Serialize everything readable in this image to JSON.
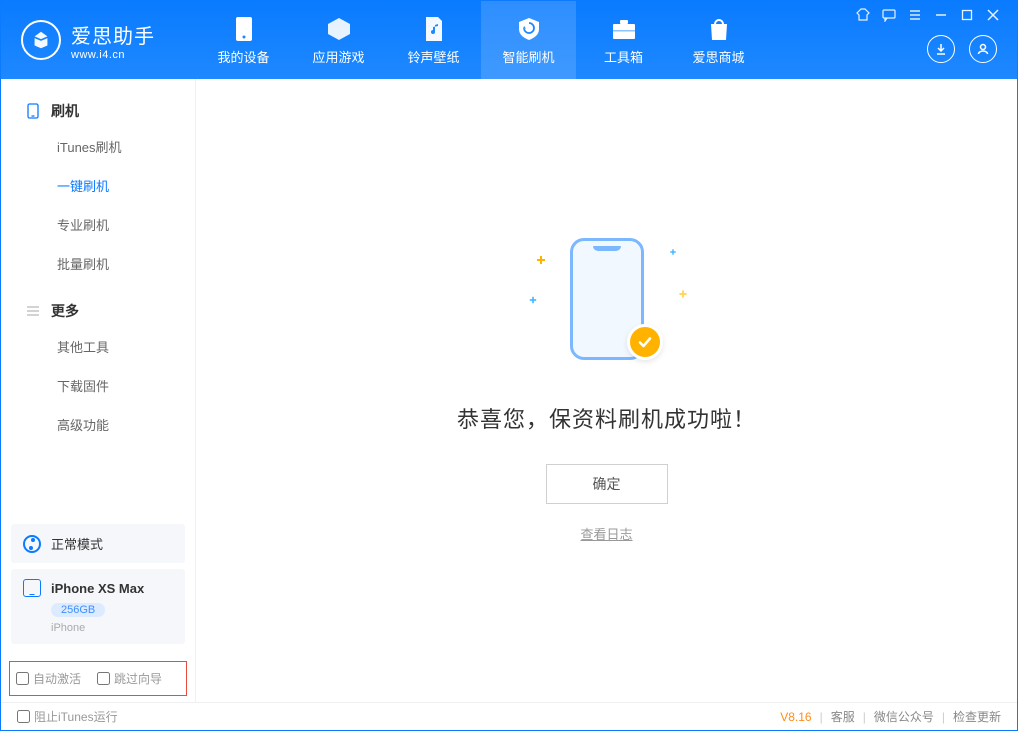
{
  "app": {
    "name": "爱思助手",
    "url": "www.i4.cn"
  },
  "tabs": [
    {
      "label": "我的设备"
    },
    {
      "label": "应用游戏"
    },
    {
      "label": "铃声壁纸"
    },
    {
      "label": "智能刷机"
    },
    {
      "label": "工具箱"
    },
    {
      "label": "爱思商城"
    }
  ],
  "sidebar": {
    "group1": {
      "title": "刷机",
      "items": [
        "iTunes刷机",
        "一键刷机",
        "专业刷机",
        "批量刷机"
      ]
    },
    "group2": {
      "title": "更多",
      "items": [
        "其他工具",
        "下载固件",
        "高级功能"
      ]
    }
  },
  "mode": {
    "label": "正常模式"
  },
  "device": {
    "name": "iPhone XS Max",
    "capacity": "256GB",
    "type": "iPhone"
  },
  "checks": {
    "auto_activate": "自动激活",
    "skip_guide": "跳过向导"
  },
  "main": {
    "success_text": "恭喜您，保资料刷机成功啦！",
    "ok_button": "确定",
    "view_log": "查看日志"
  },
  "footer": {
    "block_itunes": "阻止iTunes运行",
    "version": "V8.16",
    "service": "客服",
    "wechat": "微信公众号",
    "update": "检查更新"
  }
}
